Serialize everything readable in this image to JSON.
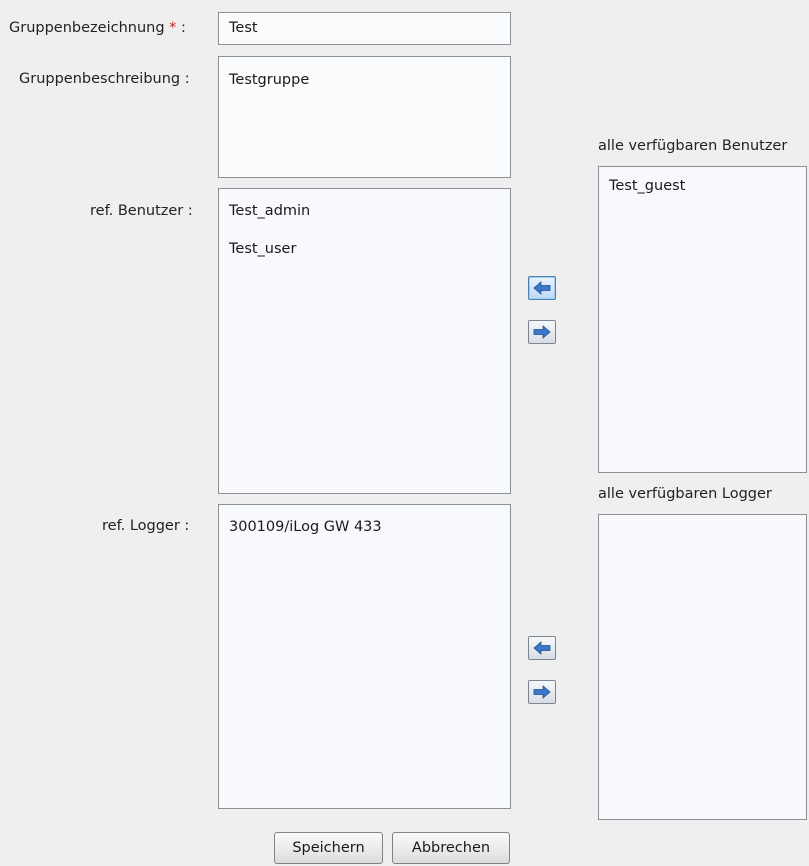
{
  "form": {
    "group_name": {
      "label": "Gruppenbezeichnung",
      "required_mark": "*",
      "colon": ":",
      "value": "Test"
    },
    "group_description": {
      "label": "Gruppenbeschreibung :",
      "value": "Testgruppe"
    },
    "ref_users": {
      "label": "ref. Benutzer :",
      "items": [
        "Test_admin",
        "Test_user"
      ]
    },
    "available_users": {
      "label": "alle verfügbaren Benutzer",
      "items": [
        "Test_guest"
      ]
    },
    "ref_loggers": {
      "label": "ref. Logger :",
      "items": [
        "300109/iLog GW 433"
      ]
    },
    "available_loggers": {
      "label": "alle verfügbaren Logger",
      "items": []
    }
  },
  "icons": {
    "move_left": "arrow-left-icon",
    "move_right": "arrow-right-icon",
    "arrow_color": "#3a78c8"
  },
  "buttons": {
    "save": "Speichern",
    "cancel": "Abbrechen"
  }
}
